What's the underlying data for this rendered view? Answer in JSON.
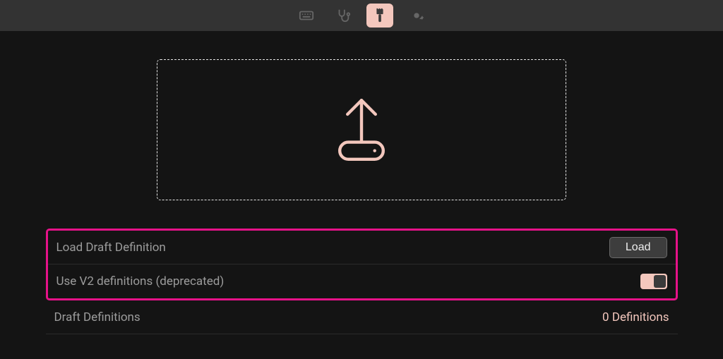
{
  "tabs": [
    {
      "name": "keyboard",
      "active": false
    },
    {
      "name": "stethoscope",
      "active": false
    },
    {
      "name": "brush",
      "active": true
    },
    {
      "name": "gear",
      "active": false
    }
  ],
  "dropzone": {
    "icon": "upload"
  },
  "rows": {
    "loadDraft": {
      "label": "Load Draft Definition",
      "button": "Load"
    },
    "useV2": {
      "label": "Use V2 definitions (deprecated)",
      "value": false
    },
    "draftDefs": {
      "label": "Draft Definitions",
      "count_text": "0 Definitions"
    }
  },
  "highlight": true,
  "colors": {
    "accent": "#f3c7bd",
    "highlight": "#e61289"
  }
}
